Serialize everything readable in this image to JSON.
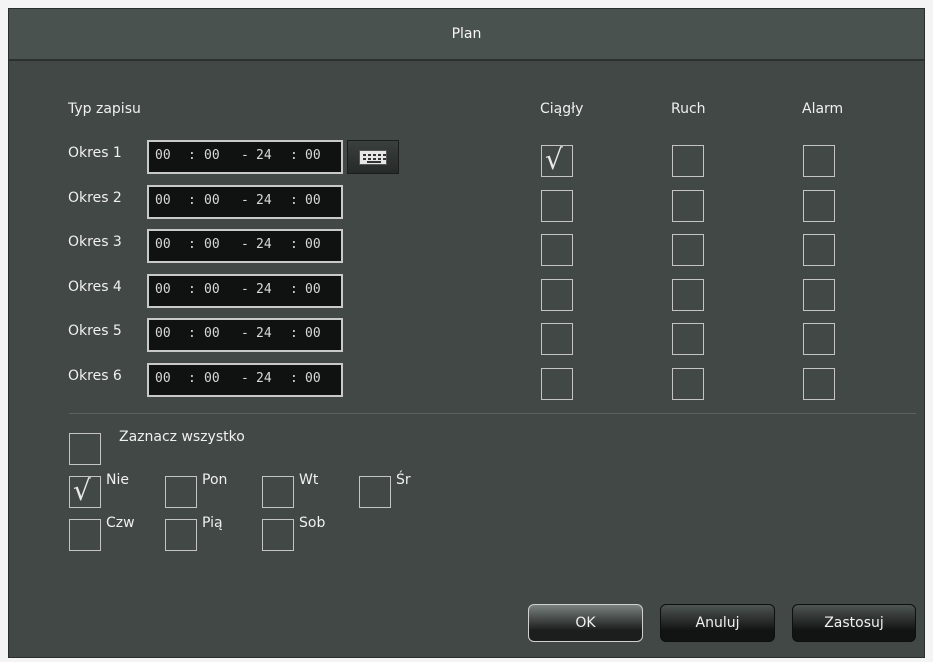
{
  "dialog": {
    "title": "Plan"
  },
  "headers": {
    "record_type": "Typ zapisu",
    "continuous": "Ciągły",
    "motion": "Ruch",
    "alarm": "Alarm"
  },
  "periods": [
    {
      "label": "Okres 1",
      "start_h": "00",
      "start_m": "00",
      "end_h": "24",
      "end_m": "00",
      "continuous": true,
      "motion": false,
      "alarm": false
    },
    {
      "label": "Okres 2",
      "start_h": "00",
      "start_m": "00",
      "end_h": "24",
      "end_m": "00",
      "continuous": false,
      "motion": false,
      "alarm": false
    },
    {
      "label": "Okres 3",
      "start_h": "00",
      "start_m": "00",
      "end_h": "24",
      "end_m": "00",
      "continuous": false,
      "motion": false,
      "alarm": false
    },
    {
      "label": "Okres 4",
      "start_h": "00",
      "start_m": "00",
      "end_h": "24",
      "end_m": "00",
      "continuous": false,
      "motion": false,
      "alarm": false
    },
    {
      "label": "Okres 5",
      "start_h": "00",
      "start_m": "00",
      "end_h": "24",
      "end_m": "00",
      "continuous": false,
      "motion": false,
      "alarm": false
    },
    {
      "label": "Okres 6",
      "start_h": "00",
      "start_m": "00",
      "end_h": "24",
      "end_m": "00",
      "continuous": false,
      "motion": false,
      "alarm": false
    }
  ],
  "time_separators": {
    "colon": ":",
    "dash": "-"
  },
  "select_all": {
    "label": "Zaznacz wszystko",
    "checked": false
  },
  "days": [
    {
      "label": "Nie",
      "checked": true
    },
    {
      "label": "Pon",
      "checked": false
    },
    {
      "label": "Wt",
      "checked": false
    },
    {
      "label": "Śr",
      "checked": false
    },
    {
      "label": "Czw",
      "checked": false
    },
    {
      "label": "Pią",
      "checked": false
    },
    {
      "label": "Sob",
      "checked": false
    }
  ],
  "buttons": {
    "ok": "OK",
    "cancel": "Anuluj",
    "apply": "Zastosuj"
  },
  "icons": {
    "keyboard": "keyboard-icon",
    "check": "check-icon"
  },
  "colors": {
    "panel": "#414845",
    "title_bar": "#4a524f",
    "field_bg": "#101211"
  }
}
